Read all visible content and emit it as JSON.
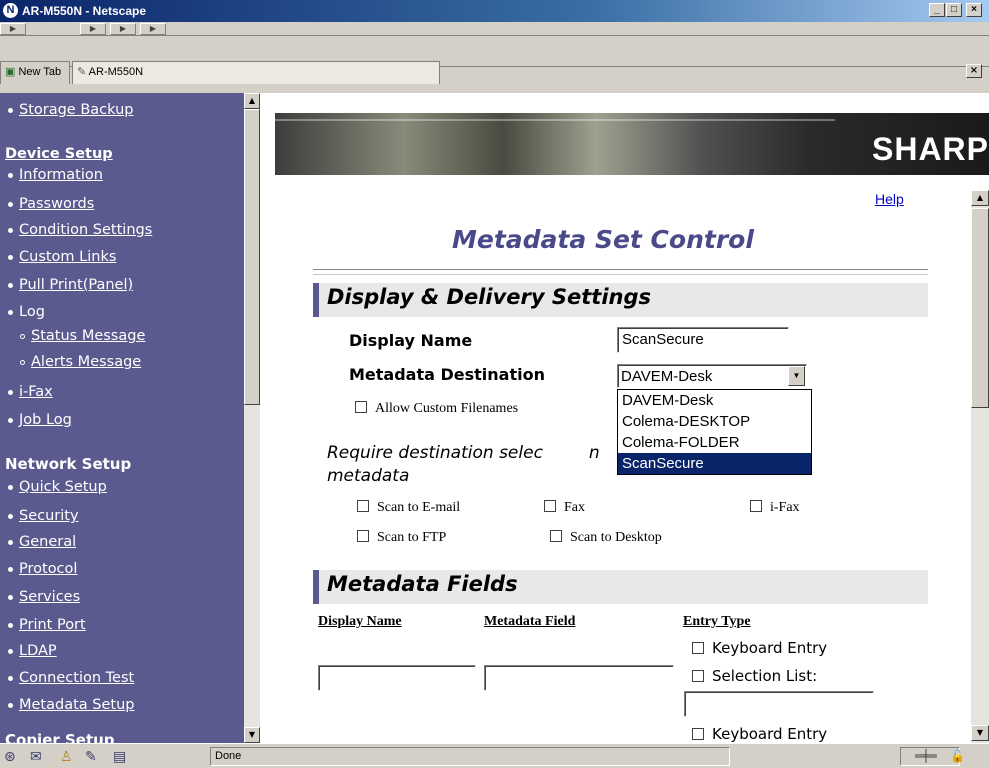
{
  "window": {
    "title": "AR-M550N - Netscape"
  },
  "tabs": [
    {
      "label": "New Tab"
    },
    {
      "label": "AR-M550N"
    }
  ],
  "sidebar": {
    "top_link": "Storage Backup",
    "device_setup": {
      "heading": "Device Setup",
      "items": [
        {
          "label": "Information"
        },
        {
          "label": "Passwords"
        },
        {
          "label": "Condition Settings"
        },
        {
          "label": "Custom Links"
        },
        {
          "label": "Pull Print(Panel)"
        },
        {
          "label": "Log"
        },
        {
          "label": "Status Message"
        },
        {
          "label": "Alerts Message"
        },
        {
          "label": "i-Fax"
        },
        {
          "label": "Job Log"
        }
      ]
    },
    "network_setup": {
      "heading": "Network Setup",
      "items": [
        {
          "label": "Quick Setup"
        },
        {
          "label": "Security"
        },
        {
          "label": "General"
        },
        {
          "label": "Protocol"
        },
        {
          "label": "Services"
        },
        {
          "label": "Print Port"
        },
        {
          "label": "LDAP"
        },
        {
          "label": "Connection Test"
        },
        {
          "label": "Metadata Setup"
        }
      ]
    },
    "next_heading": "Copier Setup"
  },
  "main": {
    "logo": "SHARP",
    "help": "Help",
    "page_title": "Metadata Set Control",
    "display_section": {
      "heading": "Display & Delivery Settings",
      "display_name_label": "Display Name",
      "display_name_value": "ScanSecure",
      "destination_label": "Metadata Destination",
      "destination_value": "DAVEM-Desk",
      "destination_options": [
        "DAVEM-Desk",
        "Colema-DESKTOP",
        "Colema-FOLDER",
        "ScanSecure"
      ],
      "destination_highlighted": "ScanSecure",
      "allow_custom": "Allow Custom Filenames",
      "require_text": "Require destination selec",
      "require_text_tail": "n",
      "require_text_line2": "metadata",
      "checks": {
        "email": "Scan to E-mail",
        "fax": "Fax",
        "ifax": "i-Fax",
        "ftp": "Scan to FTP",
        "desktop": "Scan to Desktop"
      }
    },
    "fields_section": {
      "heading": "Metadata Fields",
      "col_display": "Display Name",
      "col_field": "Metadata Field",
      "col_entry": "Entry Type",
      "entry_keyboard": "Keyboard Entry",
      "entry_selection": "Selection List:",
      "entry_keyboard2": "Keyboard Entry"
    }
  },
  "status": {
    "text": "Done"
  }
}
